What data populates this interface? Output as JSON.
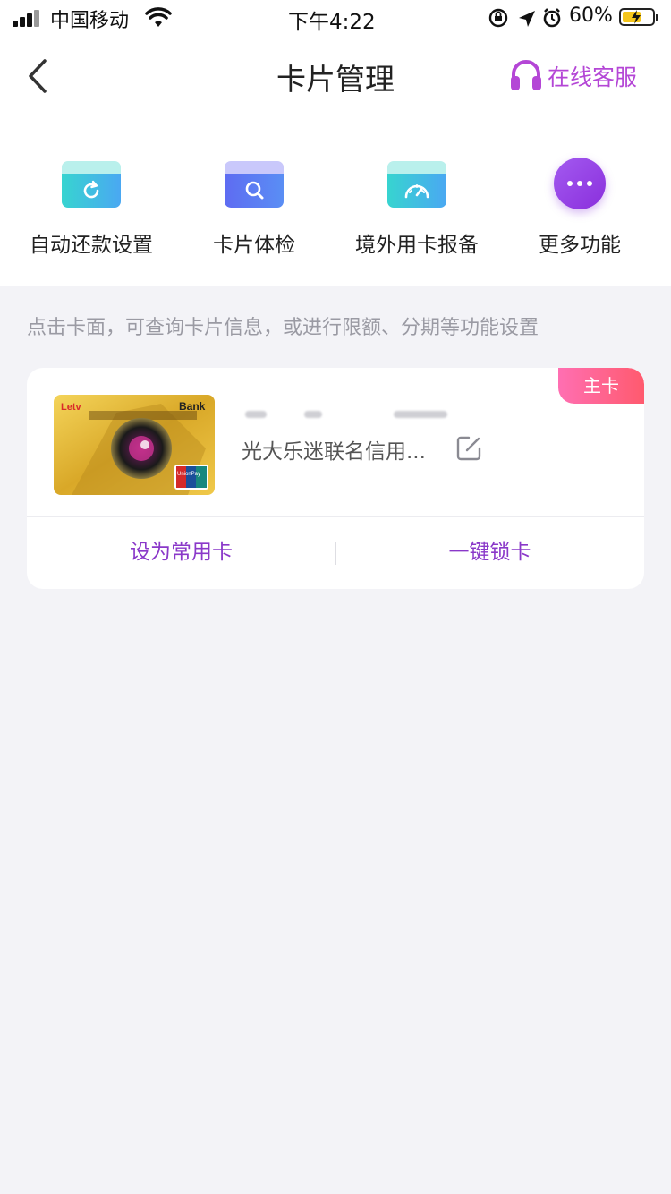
{
  "status_bar": {
    "carrier": "中国移动",
    "time": "下午4:22",
    "battery": "60%"
  },
  "nav": {
    "title": "卡片管理",
    "service_label": "在线客服"
  },
  "features": [
    {
      "label": "自动还款设置",
      "icon": "auto-repay-icon"
    },
    {
      "label": "卡片体检",
      "icon": "card-check-icon"
    },
    {
      "label": "境外用卡报备",
      "icon": "overseas-report-icon"
    },
    {
      "label": "更多功能",
      "icon": "more-icon"
    }
  ],
  "hint": "点击卡面，可查询卡片信息，或进行限额、分期等功能设置",
  "card": {
    "tag": "主卡",
    "name": "光大乐迷联名信用...",
    "actions": {
      "set_default": "设为常用卡",
      "lock": "一键锁卡"
    },
    "card_face": {
      "brand_left": "Letv",
      "brand_right": "Bank",
      "network": "UnionPay"
    }
  },
  "colors": {
    "accent_purple": "#8a38c9",
    "service_purple": "#b446d6",
    "tag_pink": "#ff6fb2",
    "background": "#f3f3f7"
  }
}
